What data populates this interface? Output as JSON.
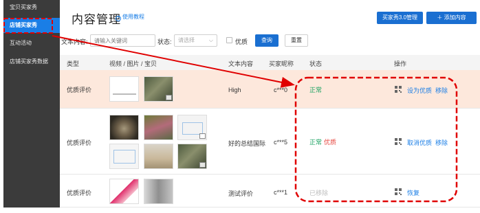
{
  "sidebar": {
    "items": [
      {
        "label": "宝贝买家秀",
        "active": false
      },
      {
        "label": "店铺买家秀",
        "active": true
      },
      {
        "label": "互动活动",
        "active": false
      },
      {
        "label": "店铺买家秀数据",
        "active": false
      }
    ]
  },
  "header": {
    "title": "内容管理",
    "help": "使用教程",
    "btn_manage": "买家秀3.0管理",
    "btn_add": "＋ 添加内容"
  },
  "filter": {
    "text_label": "文本内容:",
    "text_placeholder": "请输入关键词",
    "status_label": "状态:",
    "status_placeholder": "请选择",
    "quality_label": "优质",
    "query_button": "查询",
    "reset_button": "重置"
  },
  "table": {
    "headers": {
      "type": "类型",
      "media": "视频 / 图片 / 宝贝",
      "text": "文本内容",
      "nick": "买家昵称",
      "status": "状态",
      "ops": "操作"
    },
    "rows": [
      {
        "type": "优质评价",
        "text": "High",
        "nick": "c***0",
        "status": "正常",
        "quality": "",
        "op1": "设为优质",
        "op2": "移除"
      },
      {
        "type": "优质评价",
        "text": "好的总结国际",
        "nick": "c***5",
        "status": "正常",
        "quality": "优质",
        "op1": "取消优质",
        "op2": "移除"
      },
      {
        "type": "优质评价",
        "text": "测试评价",
        "nick": "c***1",
        "status": "已移除",
        "quality": "",
        "op1": "恢复",
        "op2": ""
      }
    ]
  },
  "colors": {
    "accent": "#1a7ee6",
    "sidebar_bg": "#3b3b3b",
    "highlight_row": "#fde8dc",
    "annotation": "#e00000"
  }
}
